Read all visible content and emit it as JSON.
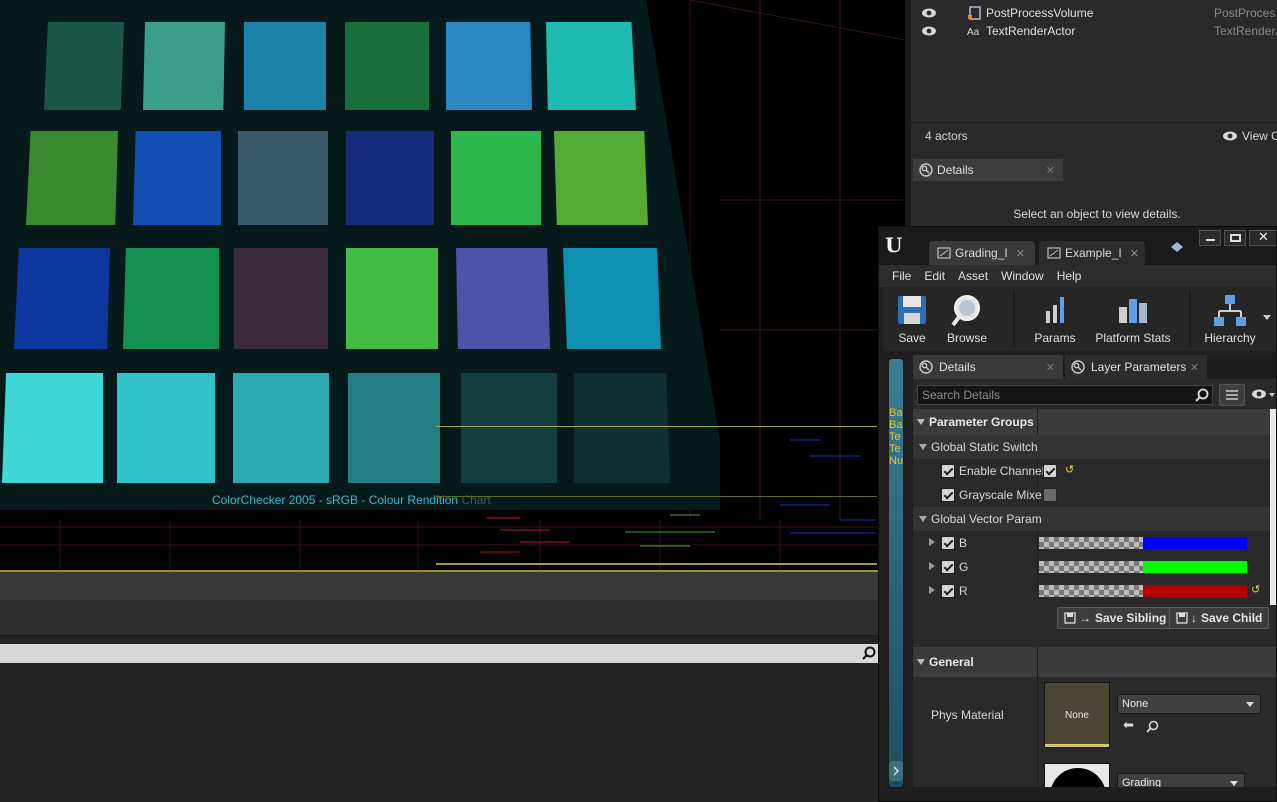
{
  "colors": {
    "swatches_row1": [
      "#1c5646",
      "#3a9e88",
      "#1c82a8",
      "#18703c",
      "#2a87c4",
      "#1ebcb0"
    ],
    "swatches_row2": [
      "#3a8a32",
      "#124eb4",
      "#3a5a6a",
      "#152b7a",
      "#2cb84c",
      "#54ac34"
    ],
    "swatches_row3": [
      "#0c38a0",
      "#149050",
      "#3c2a36",
      "#44bc44",
      "#4b55a8",
      "#0e90b2"
    ],
    "swatches_row4": [
      "#40d8d6",
      "#30c2c8",
      "#2ca8b0",
      "#227e80",
      "#133f40",
      "#0f2f31"
    ],
    "param_b": "#0000ff",
    "param_g": "#00ff00",
    "param_r": "#b80000"
  },
  "viewport": {
    "caption": "ColorChecker 2005 - sRGB - Colour Rendition",
    "caption_faded": "Chart"
  },
  "outliner": {
    "actors": [
      {
        "name": "PostProcessVolume",
        "type": "PostProces",
        "icon": "post-process-volume-icon"
      },
      {
        "name": "TextRenderActor",
        "type": "TextRenderA",
        "icon": "text-render-icon"
      }
    ],
    "count": "4 actors",
    "view_options": "View O",
    "details_tab": "Details",
    "select_hint": "Select an object to view details."
  },
  "editor": {
    "tabs": [
      "Grading_I",
      "Example_I"
    ],
    "menu": [
      "File",
      "Edit",
      "Asset",
      "Window",
      "Help"
    ],
    "toolbar": {
      "save": "Save",
      "browse": "Browse",
      "params": "Params",
      "platform_stats": "Platform Stats",
      "hierarchy": "Hierarchy"
    },
    "rail_text": "Ba Ba Te Te Nu",
    "details": {
      "tab_details": "Details",
      "tab_layer_params": "Layer Parameters",
      "search_placeholder": "Search Details",
      "parameter_groups": "Parameter Groups",
      "global_static_switch": "Global Static Switch",
      "enable_channel": "Enable ChannelI",
      "grayscale_mixer": "Grayscale Mixe",
      "global_vector_param": "Global Vector Param",
      "param_b": "B",
      "param_g": "G",
      "param_r": "R",
      "save_sibling": "Save Sibling",
      "save_child": "Save Child",
      "general": "General",
      "phys_material": "Phys Material",
      "phys_thumb": "None",
      "phys_dropdown": "None",
      "grading_dropdown": "Grading"
    }
  }
}
